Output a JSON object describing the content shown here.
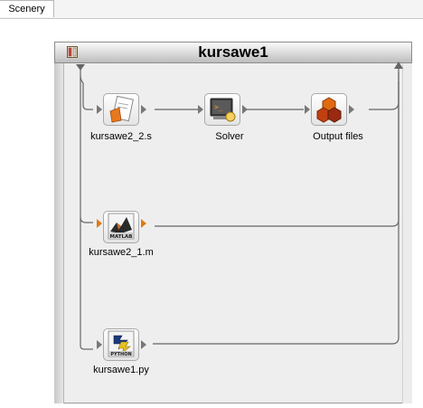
{
  "tabs": [
    {
      "label": "Scenery"
    }
  ],
  "workflow": {
    "title": "kursawe1",
    "nodes": [
      {
        "id": "kursawe2_2_s",
        "label": "kursawe2_2.s",
        "icon": "script-file-icon"
      },
      {
        "id": "solver",
        "label": "Solver",
        "icon": "solver-terminal-icon"
      },
      {
        "id": "output_files",
        "label": "Output files",
        "icon": "output-files-icon"
      },
      {
        "id": "kursawe2_1_m",
        "label": "kursawe2_1.m",
        "icon": "matlab-icon",
        "icon_text": "MATLAB"
      },
      {
        "id": "kursawe1_py",
        "label": "kursawe1.py",
        "icon": "python-icon",
        "icon_text": "PYTHON"
      }
    ]
  },
  "colors": {
    "wire": "#666666",
    "port": "#777777",
    "active_port": "#e07a10",
    "frame": "#eeeeee"
  }
}
